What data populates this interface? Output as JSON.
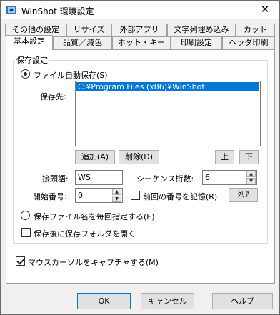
{
  "window": {
    "title": "WinShot 環境設定",
    "close_glyph": "✕"
  },
  "tabs_back": [
    "その他の設定",
    "リサイズ",
    "外部アプリ",
    "文字列埋め込み",
    "カット"
  ],
  "tabs_front": [
    "基本設定",
    "品質／減色",
    "ホット・キー",
    "印刷設定",
    "ヘッダ印刷"
  ],
  "save_group": {
    "title": "保存設定",
    "auto_save_label": "ファイル自動保存(S)",
    "auto_save_checked": true,
    "dest_label": "保存先:",
    "paths": [
      "C:¥Program Files (x86)¥WinShot"
    ],
    "add_label": "追加(A)",
    "delete_label": "削除(D)",
    "up_label": "上",
    "down_label": "下",
    "prefix_label": "接頭語:",
    "prefix_value": "WS",
    "seq_digits_label": "シーケンス桁数:",
    "seq_digits_value": "6",
    "start_label": "開始番号:",
    "start_value": "0",
    "remember_label": "前回の番号を記憶(R)",
    "remember_checked": false,
    "clear_label": "ｸﾘｱ",
    "specify_label": "保存ファイル名を毎回指定する(E)",
    "specify_checked": false,
    "open_folder_label": "保存後に保存フォルダを開く",
    "open_folder_checked": false
  },
  "capture_cursor_label": "マウスカーソルをキャプチャする(M)",
  "capture_cursor_checked": true,
  "footer": {
    "ok": "OK",
    "cancel": "キャンセル",
    "help": "ヘルプ"
  },
  "icons": {
    "app": "winshot-app-icon",
    "spin_up": "▲",
    "spin_down": "▼"
  }
}
